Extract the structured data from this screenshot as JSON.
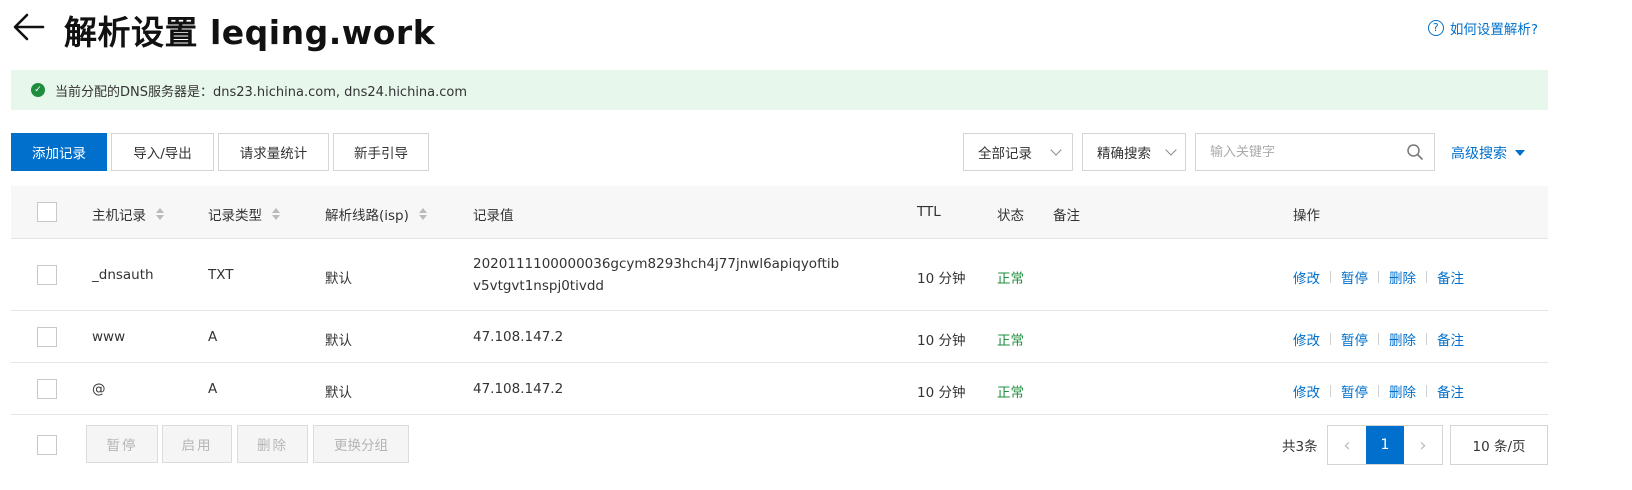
{
  "header": {
    "title": "解析设置 leqing.work",
    "help_link": "如何设置解析?",
    "help_icon": "?"
  },
  "banner": {
    "text": "当前分配的DNS服务器是：dns23.hichina.com, dns24.hichina.com",
    "status_color": "#1e8e3e"
  },
  "toolbar": {
    "add_record": "添加记录",
    "import_export": "导入/导出",
    "request_stats": "请求量统计",
    "guide": "新手引导",
    "filter_select": "全部记录",
    "search_mode": "精确搜索",
    "search_placeholder": "输入关键字",
    "advanced_search": "高级搜索"
  },
  "table": {
    "columns": {
      "host": "主机记录",
      "type": "记录类型",
      "line": "解析线路(isp)",
      "value": "记录值",
      "ttl": "TTL",
      "status": "状态",
      "remark": "备注",
      "actions": "操作"
    },
    "rows": [
      {
        "host": "_dnsauth",
        "type": "TXT",
        "line": "默认",
        "value": "2020111100000036gcym8293hch4j77jnwl6apiqyoftibv5vtgvt1nspj0tivdd",
        "ttl": "10 分钟",
        "status": "正常",
        "remark": ""
      },
      {
        "host": "www",
        "type": "A",
        "line": "默认",
        "value": "47.108.147.2",
        "ttl": "10 分钟",
        "status": "正常",
        "remark": ""
      },
      {
        "host": "@",
        "type": "A",
        "line": "默认",
        "value": "47.108.147.2",
        "ttl": "10 分钟",
        "status": "正常",
        "remark": ""
      }
    ],
    "row_actions": {
      "edit": "修改",
      "pause": "暂停",
      "delete": "删除",
      "remark": "备注"
    }
  },
  "footer": {
    "batch_pause": "暂停",
    "batch_enable": "启用",
    "batch_delete": "删除",
    "batch_change_group": "更换分组",
    "total": "共3条",
    "prev": "‹",
    "current_page": "1",
    "next": "›",
    "page_size": "10 条/页"
  },
  "colors": {
    "accent": "#0070cc",
    "success": "#1e8e3e",
    "banner_bg": "#e8f7ec"
  }
}
